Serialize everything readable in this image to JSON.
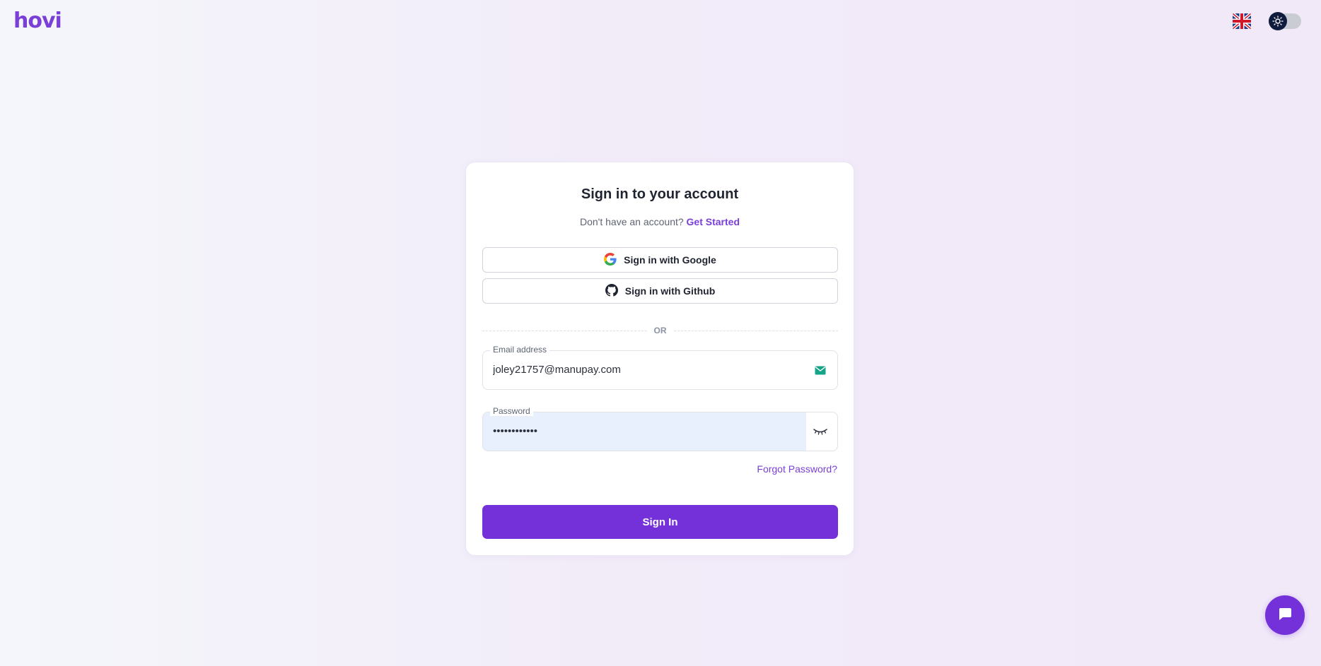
{
  "brand": {
    "logo_text": "hovi",
    "accent_color": "#7430d9"
  },
  "header": {
    "language_icon": "uk-flag-icon",
    "theme_toggle_icon": "sun-icon",
    "theme_toggle_state": "off"
  },
  "card": {
    "title": "Sign in to your account",
    "subtitle_text": "Don't have an account?",
    "subtitle_link": "Get Started",
    "google_label": "Sign in with Google",
    "github_label": "Sign in with Github",
    "divider_text": "OR",
    "email": {
      "label": "Email address",
      "value": "joley21757@manupay.com",
      "icon": "mail-check-icon"
    },
    "password": {
      "label": "Password",
      "value": "••••••••••••",
      "icon": "eye-closed-icon"
    },
    "forgot_label": "Forgot Password?",
    "submit_label": "Sign In"
  },
  "chat_widget": {
    "icon": "chat-bubble-icon"
  }
}
